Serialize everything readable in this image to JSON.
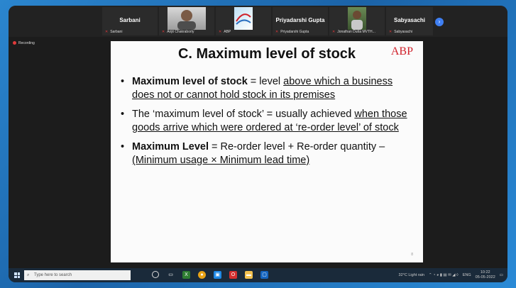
{
  "participants": [
    {
      "name": "Sarbani",
      "sub": "Sarbani",
      "photo": "none"
    },
    {
      "name": "",
      "sub": "Arijit Chakraborty",
      "photo": "person"
    },
    {
      "name": "",
      "sub": "ABP",
      "photo": "logo"
    },
    {
      "name": "Priyadarshi Gupta",
      "sub": "Priyadarshi Gupta",
      "photo": "none"
    },
    {
      "name": "",
      "sub": "Jonathan Dutta MVTH...",
      "photo": "person2"
    },
    {
      "name": "Sabyasachi",
      "sub": "Sabyasachi",
      "photo": "none"
    }
  ],
  "recording_label": "Recording",
  "slide": {
    "title": "C. Maximum level of stock",
    "logo": "ABP",
    "bullets": {
      "b1_bold": "Maximum level of stock",
      "b1_plain": " = level ",
      "b1_under": "above which a business does not or cannot hold stock in its premises",
      "b2_plain": "The ‘maximum level of stock’ = usually achieved ",
      "b2_under": "when those goods arrive which were ordered at ‘re-order level’ of stock",
      "b3_bold": "Maximum Level",
      "b3_plain": " = Re-order level + Re-order quantity – ",
      "b3_under": "(Minimum usage × Minimum lead time)"
    },
    "page_number": "8"
  },
  "taskbar": {
    "search_placeholder": "Type here to search",
    "weather": "32°C Light rain",
    "language": "ENG",
    "time": "10:22",
    "date": "05-05-2022"
  },
  "colors": {
    "frame_blue": "#1f6fb3",
    "mic_muted": "#e0373a",
    "logo_red": "#d0202a",
    "next_button": "#3f7ff2"
  }
}
